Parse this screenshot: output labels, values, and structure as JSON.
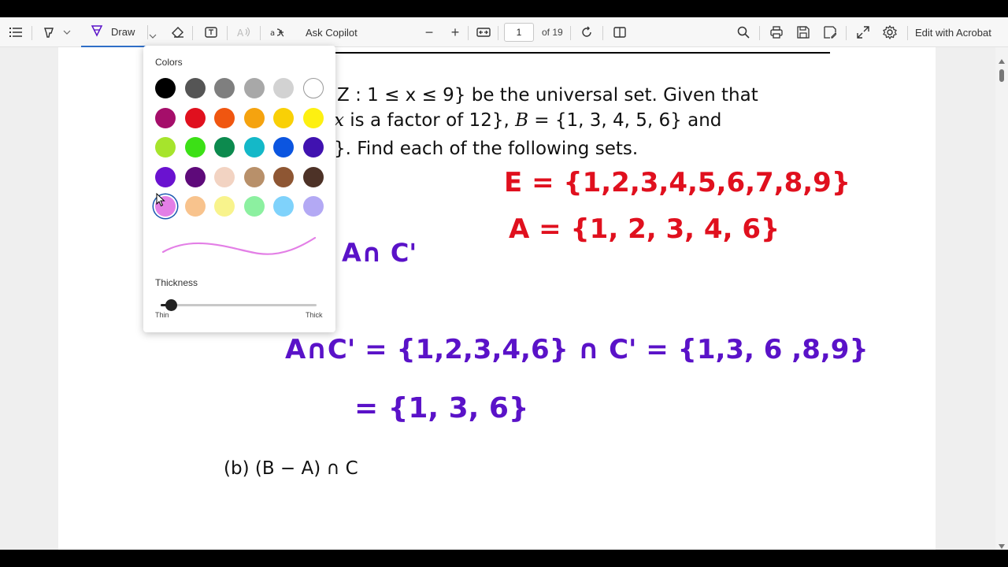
{
  "toolbar": {
    "draw_label": "Draw",
    "ask_copilot_label": "Ask Copilot",
    "zoom_out": "−",
    "zoom_in": "+",
    "page_current": "1",
    "page_total": "of 19",
    "edit_label": "Edit with Acrobat",
    "accent_color": "#2f6ec7"
  },
  "draw_popup": {
    "colors_title": "Colors",
    "thickness_title": "Thickness",
    "thin_label": "Thin",
    "thick_label": "Thick",
    "thickness_fraction": 0.07,
    "selected_color": "#e37fe6",
    "swatches": [
      [
        "#000000",
        "#555555",
        "#7f7f7f",
        "#a8a8a8",
        "#d2d2d2",
        "#ffffff"
      ],
      [
        "#a50e6a",
        "#e0101e",
        "#f05610",
        "#f5a30f",
        "#f9d006",
        "#fdf011"
      ],
      [
        "#a6e42c",
        "#3ce016",
        "#0c8a4e",
        "#14b8c8",
        "#0b55e0",
        "#4012b0"
      ],
      [
        "#6a12d0",
        "#5e0a7a",
        "#f2d3c2",
        "#b8906a",
        "#8e5633",
        "#4d3227"
      ],
      [
        "#e37fe6",
        "#f8c38d",
        "#f8f38c",
        "#8cf0a0",
        "#7fd2fb",
        "#b3a9f4"
      ]
    ]
  },
  "document": {
    "line1": "Z : 1 ≤ x ≤ 9} be the universal set.  Given that",
    "line2_a": "x",
    "line2_b": " is a factor of 12}, ",
    "line2_c": "B",
    "line2_d": " = {1, 3, 4, 5, 6} and",
    "line3": "}. Find each of the following sets.",
    "part_b": "(b)  (B − A) ∩ C"
  },
  "handwriting": {
    "red_color": "#e0101e",
    "purple_color": "#5a12c8",
    "red_line1": "E = {1,2,3,4,5,6,7,8,9}",
    "red_line2": "A = {1, 2, 3, 4, 6}",
    "purple_label": "A∩ C'",
    "purple_line1": "A∩C' = {1,2,3,4,6}  ∩ C' = {1,3,  6  ,8,9}",
    "purple_line2": "= {1, 3, 6}"
  }
}
